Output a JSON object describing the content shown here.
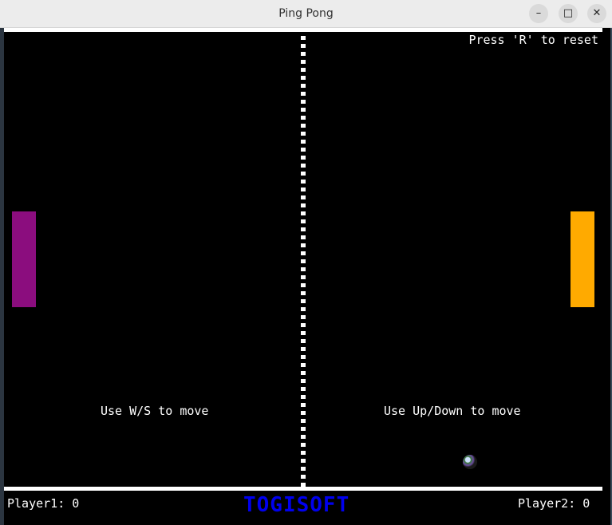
{
  "window": {
    "title": "Ping Pong",
    "minimize_icon": "minimize-icon",
    "maximize_icon": "maximize-icon",
    "close_icon": "close-icon"
  },
  "game": {
    "reset_hint": "Press 'R' to reset",
    "player1_hint": "Use W/S to move",
    "player2_hint": "Use Up/Down to move",
    "player1_score_label": "Player1: 0",
    "player2_score_label": "Player2: 0",
    "brand": "TOGISOFT",
    "colors": {
      "background": "#000000",
      "lines": "#ffffff",
      "paddle_left": "#8b0d7e",
      "paddle_right": "#ffaa00",
      "brand": "#0000ee"
    }
  }
}
